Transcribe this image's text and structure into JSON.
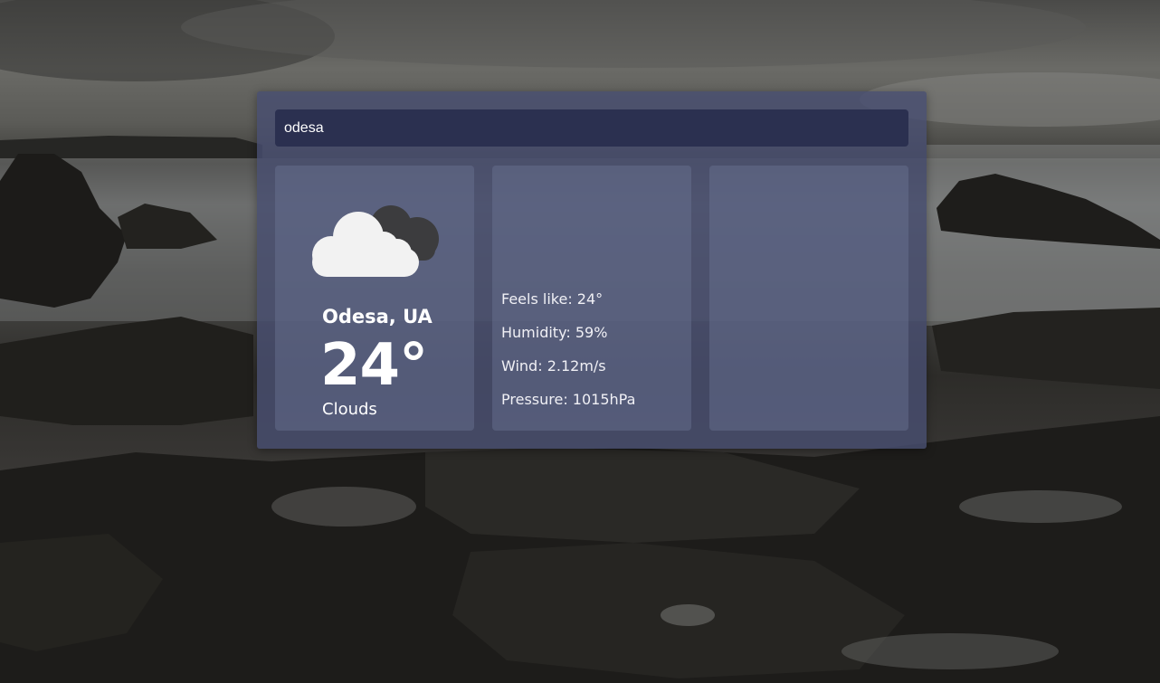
{
  "search": {
    "value": "odesa"
  },
  "current": {
    "icon": "clouds-icon",
    "city": "Odesa, UA",
    "temperature": "24°",
    "condition": "Clouds"
  },
  "details": {
    "feels_like": "Feels like: 24°",
    "humidity": "Humidity: 59%",
    "wind": "Wind: 2.12m/s",
    "pressure": "Pressure: 1015hPa"
  },
  "colors": {
    "panel": "#484e70",
    "search_bg": "#2b3050",
    "cloud_front": "#f2f2f2",
    "cloud_back": "#3c3c3e"
  }
}
